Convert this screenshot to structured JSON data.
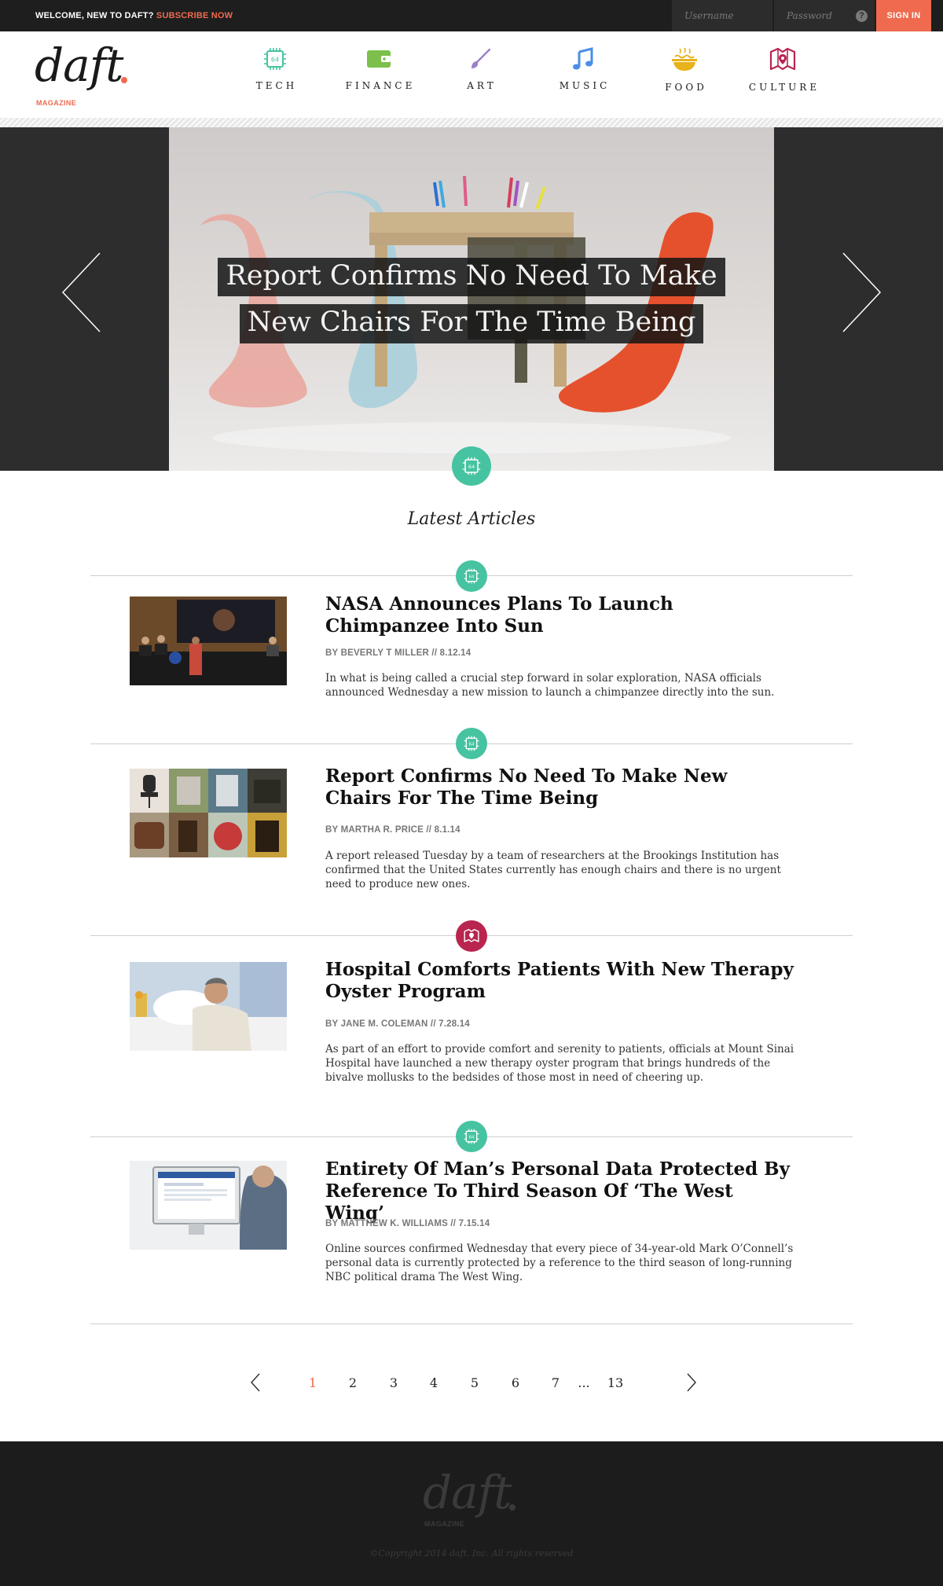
{
  "topbar": {
    "welcome_text": "WELCOME, NEW TO DAFT?",
    "subscribe_link": "SUBSCRIBE NOW",
    "username_placeholder": "Username",
    "password_placeholder": "Password",
    "help_label": "?",
    "signin_label": "SIGN IN"
  },
  "header": {
    "logo_word": "daft",
    "logo_sub": "MAGAZINE",
    "nav": [
      {
        "label": "TECH",
        "icon": "chip-icon",
        "color": "#46c3a1"
      },
      {
        "label": "FINANCE",
        "icon": "wallet-icon",
        "color": "#7cc04b"
      },
      {
        "label": "ART",
        "icon": "paintbrush-icon",
        "color": "#9b7fc7"
      },
      {
        "label": "MUSIC",
        "icon": "music-note-icon",
        "color": "#4a8ee6"
      },
      {
        "label": "FOOD",
        "icon": "noodle-bowl-icon",
        "color": "#e8b21c"
      },
      {
        "label": "CULTURE",
        "icon": "map-pin-icon",
        "color": "#b8254f"
      }
    ],
    "chip_label": "64"
  },
  "hero": {
    "title_line1": "Report Confirms No Need To Make",
    "title_line2": "New Chairs For The Time Being",
    "category_icon": "chip-icon"
  },
  "latest": {
    "heading": "Latest Articles",
    "articles": [
      {
        "category": "tech",
        "title": "NASA Announces Plans To Launch Chimpanzee Into Sun",
        "meta": "BY BEVERLY T MILLER // 8.12.14",
        "excerpt": "In what is being called a crucial step forward in solar exploration, NASA officials announced Wednesday a new mission to launch a chimpanzee directly into the sun."
      },
      {
        "category": "tech",
        "title": "Report Confirms No Need To Make New Chairs For The Time Being",
        "meta": "BY MARTHA R. PRICE // 8.1.14",
        "excerpt": "A report released Tuesday by a team of researchers at the Brookings Institution has confirmed that the United States currently has enough chairs and there is no urgent need to produce new ones."
      },
      {
        "category": "culture",
        "title": "Hospital Comforts Patients With New Therapy Oyster Program",
        "meta": "BY JANE M. COLEMAN // 7.28.14",
        "excerpt": "As part of an effort to provide comfort and serenity to patients, officials at Mount Sinai Hospital have launched a new therapy oyster program that brings hundreds of the bivalve mollusks to the bedsides of those most in need of cheering up."
      },
      {
        "category": "tech",
        "title": "Entirety Of Man’s Personal Data Protected By Reference To Third Season Of ‘The West Wing’",
        "meta": "BY MATTHEW K. WILLIAMS // 7.15.14",
        "excerpt": "Online sources confirmed Wednesday that every piece of 34-year-old Mark O’Connell’s personal data is currently protected by a reference to the third season of long-running NBC political drama The West Wing."
      }
    ]
  },
  "pagination": {
    "pages": [
      "1",
      "2",
      "3",
      "4",
      "5",
      "6",
      "7",
      "...",
      "13"
    ],
    "current": "1"
  },
  "footer": {
    "logo_word": "daft",
    "logo_sub": "MAGAZINE",
    "copyright": "©Copyright 2014 daft. Inc. All rights reserved"
  },
  "colors": {
    "accent": "#ef6a4e",
    "tech": "#46c3a1",
    "culture": "#b8254f",
    "dark": "#1e1e1e"
  }
}
